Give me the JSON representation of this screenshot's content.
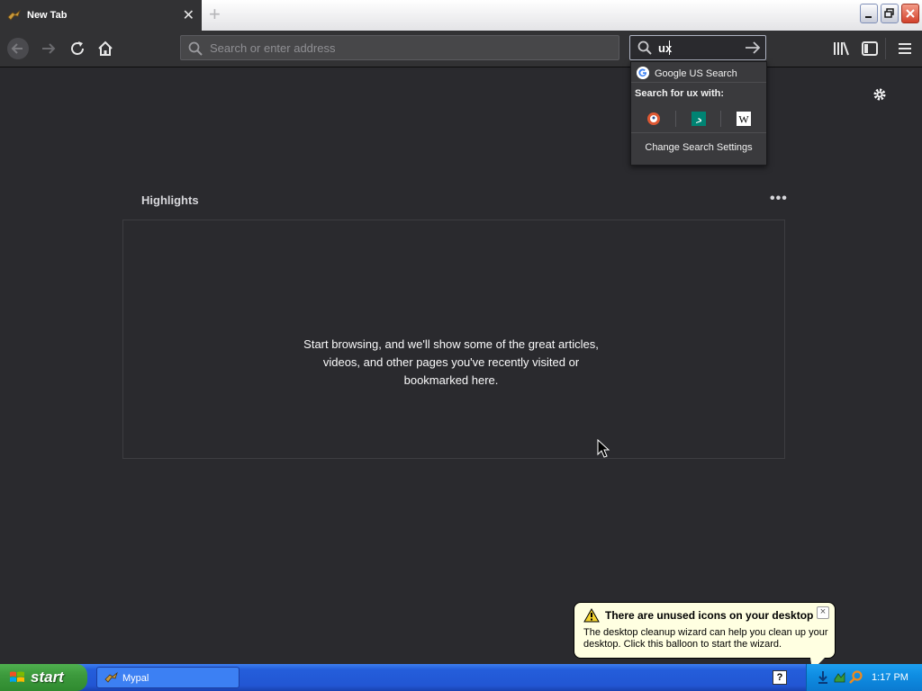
{
  "tab": {
    "title": "New Tab"
  },
  "urlbar": {
    "placeholder": "Search or enter address"
  },
  "searchbar": {
    "value": "ux"
  },
  "search_popup": {
    "top_result": "Google US Search",
    "header": "Search for ux with:",
    "engines": [
      "duckduckgo-icon",
      "bing-icon",
      "wikipedia-icon"
    ],
    "settings_label": "Change Search Settings"
  },
  "highlights": {
    "title": "Highlights",
    "more": "•••",
    "empty_message": "Start browsing, and we'll show some of the great articles, videos, and other pages you've recently visited or bookmarked here."
  },
  "balloon": {
    "title": "There are unused icons on your desktop",
    "text": "The desktop cleanup wizard can help you clean up your desktop. Click this balloon to start the wizard.",
    "close": "×"
  },
  "taskbar": {
    "start_label": "start",
    "items": [
      {
        "label": "Mypal"
      }
    ],
    "help_icon": "?",
    "time": "1:17 PM"
  },
  "colors": {
    "page_bg": "#2a2a2e",
    "toolbar_bg": "#323234",
    "balloon_bg": "#ffffe1",
    "start_green": "#3d9a3d",
    "taskbar_blue": "#245edb"
  }
}
